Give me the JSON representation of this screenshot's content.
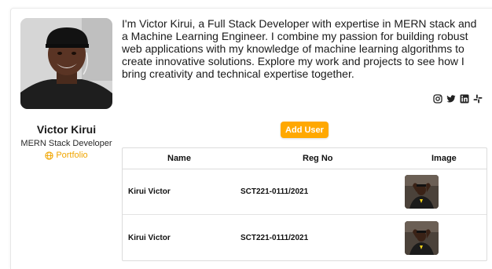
{
  "profile": {
    "name": "Victor Kirui",
    "role": "MERN Stack Developer",
    "portfolio_label": "Portfolio",
    "bio": "I'm Victor Kirui, a Full Stack Developer with expertise in MERN stack and a Machine Learning Engineer. I combine my passion for building robust web applications with my knowledge of machine learning algorithms to create innovative solutions. Explore my work and projects to see how I bring creativity and technical expertise together."
  },
  "socials": [
    "instagram-icon",
    "twitter-icon",
    "linkedin-icon",
    "slack-icon"
  ],
  "actions": {
    "add_user_label": "Add User"
  },
  "table": {
    "headers": {
      "name": "Name",
      "reg": "Reg No",
      "image": "Image"
    },
    "rows": [
      {
        "name": "Kirui Victor",
        "reg": "SCT221-0111/2021"
      },
      {
        "name": "Kirui Victor",
        "reg": "SCT221-0111/2021"
      }
    ]
  },
  "colors": {
    "accent": "#ffa800",
    "portfolio": "#f0a500"
  }
}
